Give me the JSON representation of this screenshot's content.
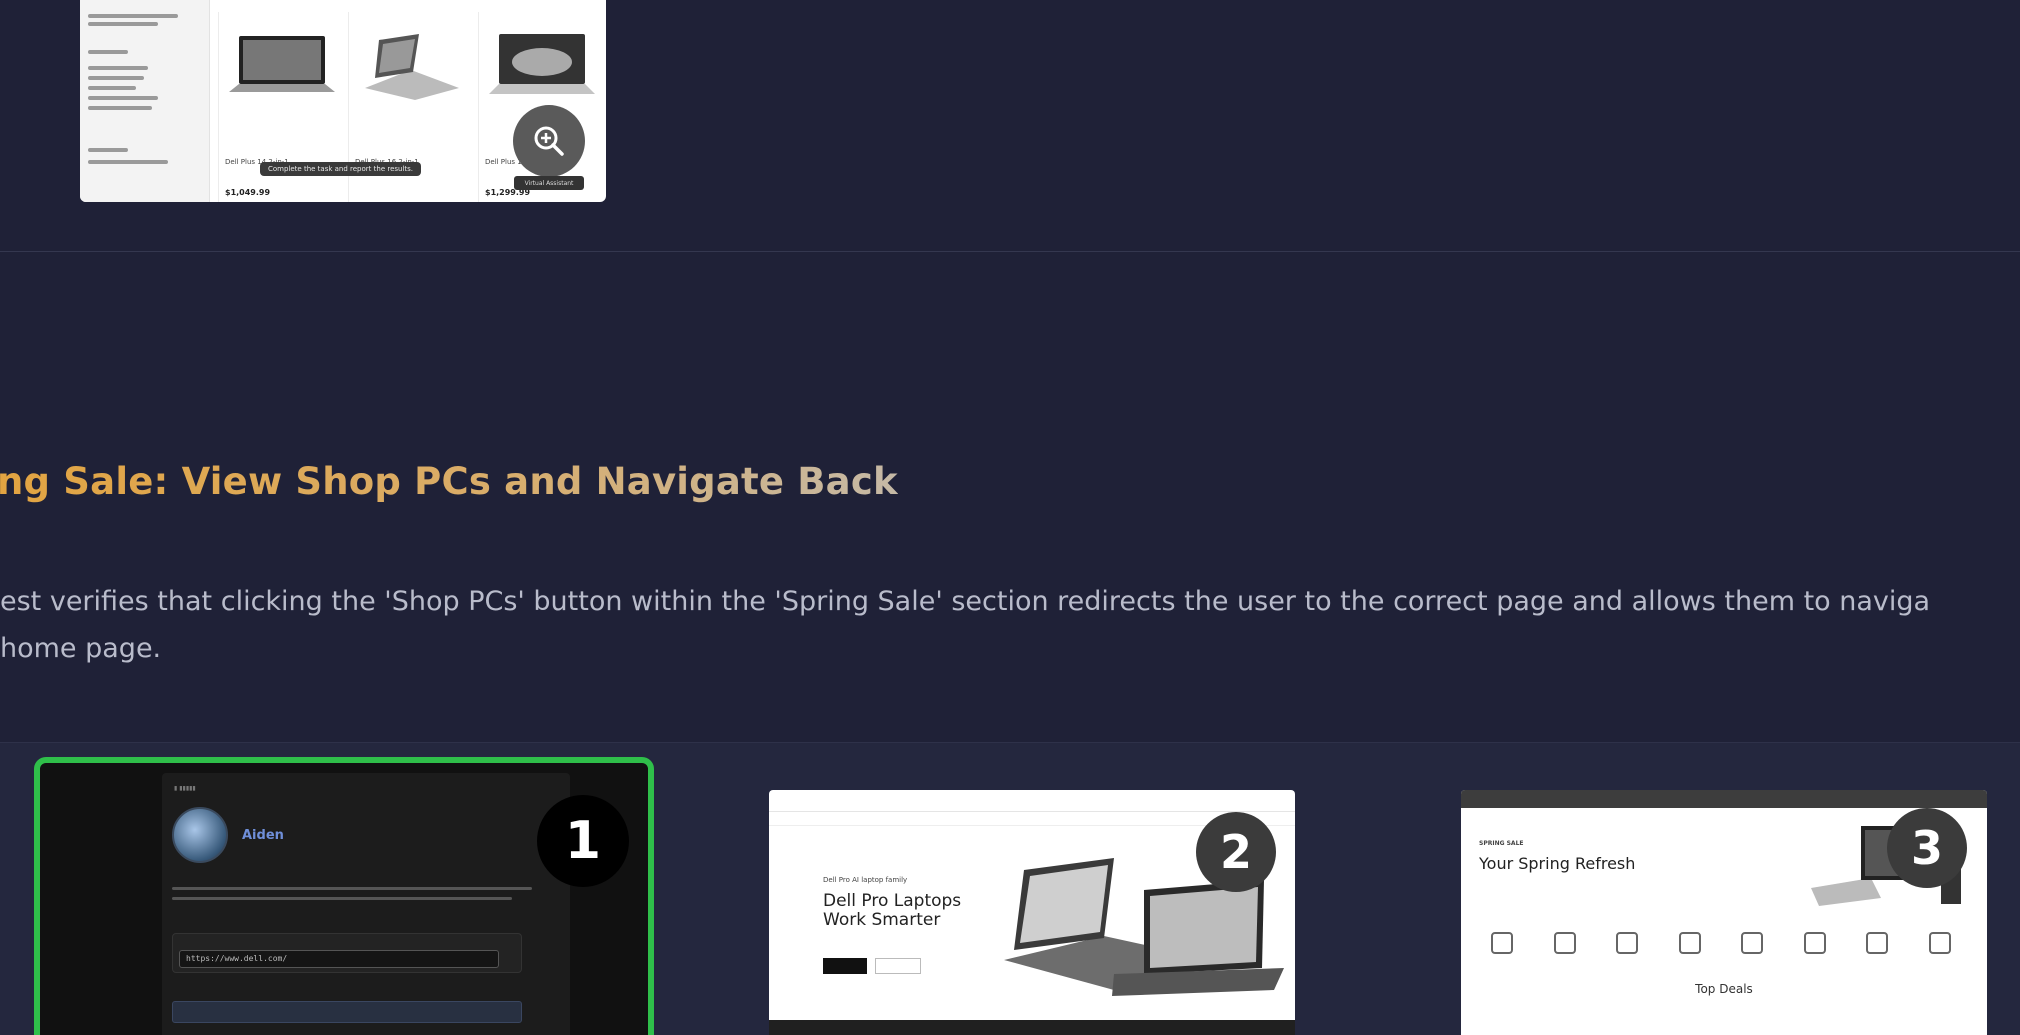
{
  "top_thumbnail": {
    "tooltip": "Complete the task and report the results.",
    "products": [
      {
        "name": "Dell Plus 14 2-in-1",
        "price": "$1,049.99"
      },
      {
        "name": "Dell Plus 16 2-in-1",
        "price": ""
      },
      {
        "name": "Dell Plus 14",
        "price": "$1,299.99"
      }
    ],
    "assist_label": "Virtual Assistant"
  },
  "section": {
    "title": "ng Sale: View Shop PCs and Navigate Back",
    "description_line1": "est verifies that clicking the 'Shop PCs' button within the 'Spring Sale' section redirects the user to the correct page and allows them to naviga",
    "description_line2": "home page."
  },
  "steps": [
    {
      "number": "1",
      "user_name": "Aiden",
      "url_value": "https://www.dell.com/"
    },
    {
      "number": "2",
      "headline": "Dell Pro Laptops Work Smarter",
      "tagline": "Dell Pro AI laptop family"
    },
    {
      "number": "3",
      "headline": "Your Spring Refresh",
      "tagline": "SPRING SALE",
      "deals_heading": "Top Deals"
    }
  ],
  "colors": {
    "background": "#1f2137",
    "step_active_border": "#2fbf4a",
    "title_gradient_start": "#e2a441"
  }
}
